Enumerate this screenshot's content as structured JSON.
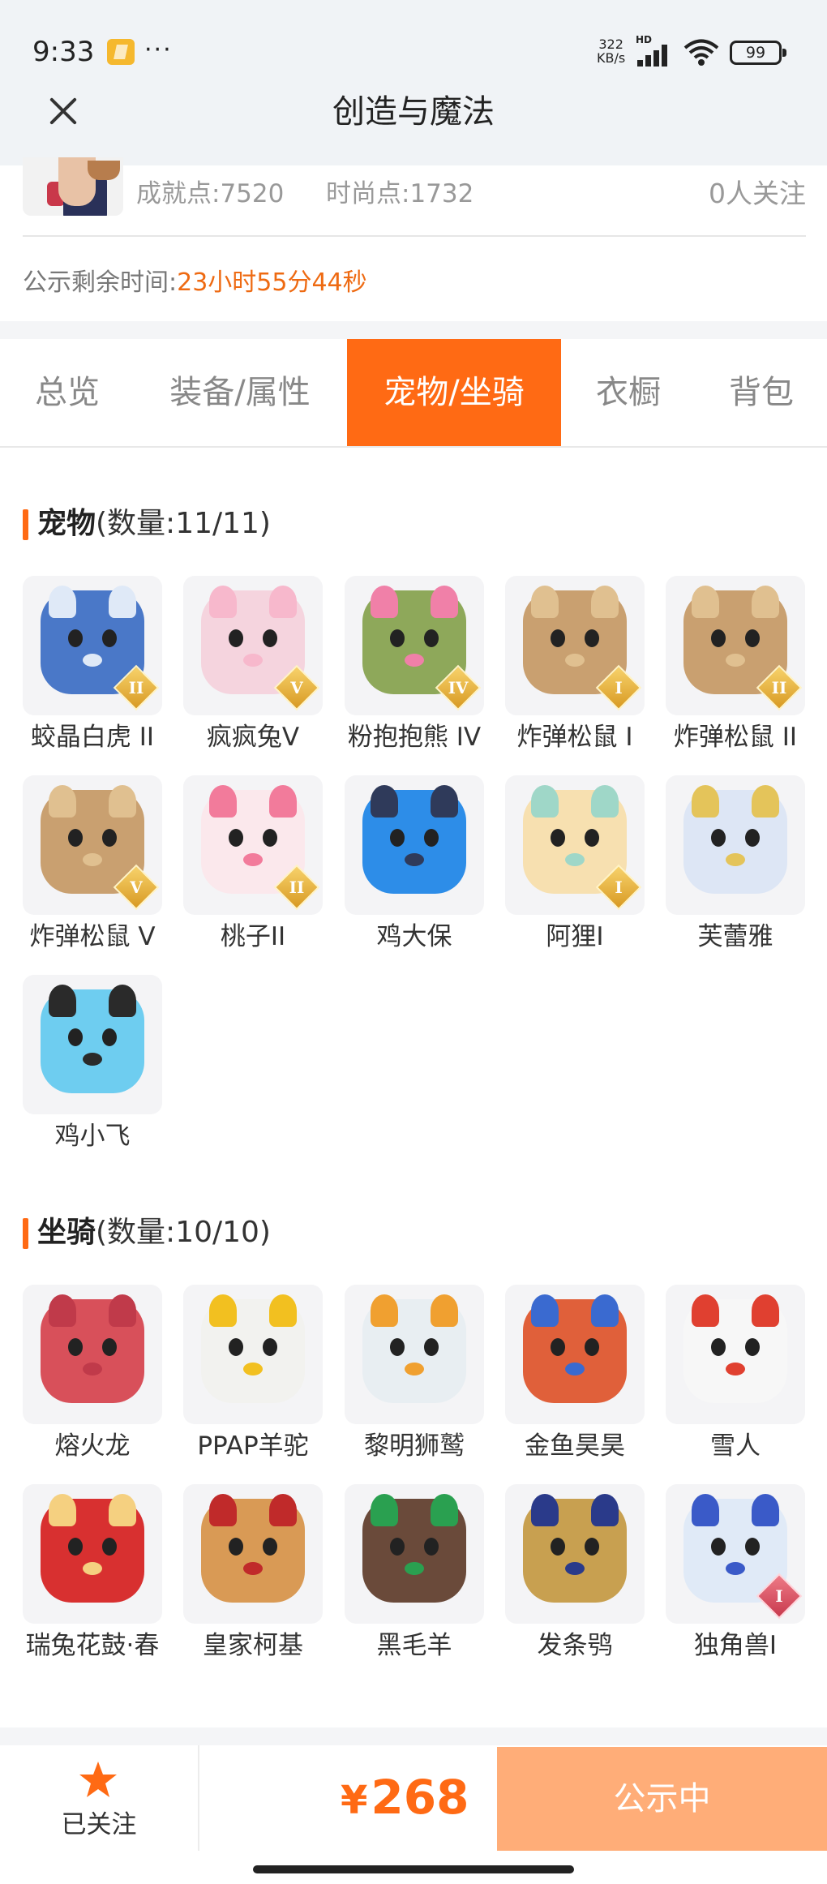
{
  "status_bar": {
    "time": "9:33",
    "more": "···",
    "speed_value": "322",
    "speed_unit": "KB/s",
    "network": "HD",
    "battery": "99"
  },
  "header": {
    "title": "创造与魔法"
  },
  "profile": {
    "achievement": "成就点:7520",
    "fashion": "时尚点:1732",
    "followers": "0人关注",
    "notice_label": "公示剩余时间:",
    "countdown": "23小时55分44秒"
  },
  "tabs": [
    {
      "label": "总览"
    },
    {
      "label": "装备/属性"
    },
    {
      "label": "宠物/坐骑"
    },
    {
      "label": "衣橱"
    },
    {
      "label": "背包"
    }
  ],
  "pets": {
    "title": "宠物",
    "count": "(数量:11/11)",
    "items": [
      {
        "name": "蛟晶白虎 II",
        "badge": "II",
        "color": "#4a78c8",
        "ear": "#dfe9f7"
      },
      {
        "name": "疯疯兔V",
        "badge": "V",
        "color": "#f5d4de",
        "ear": "#f7b8cc"
      },
      {
        "name": "粉抱抱熊 IV",
        "badge": "IV",
        "color": "#8ea85a",
        "ear": "#f080a8"
      },
      {
        "name": "炸弹松鼠 I",
        "badge": "I",
        "color": "#c9a070",
        "ear": "#e0c090"
      },
      {
        "name": "炸弹松鼠 II",
        "badge": "II",
        "color": "#c9a070",
        "ear": "#e0c090"
      },
      {
        "name": "炸弹松鼠 V",
        "badge": "V",
        "color": "#c9a070",
        "ear": "#e0c090"
      },
      {
        "name": "桃子II",
        "badge": "II",
        "color": "#fbe8ec",
        "ear": "#f27b9b"
      },
      {
        "name": "鸡大保",
        "badge": "",
        "color": "#2d8de8",
        "ear": "#2f3a5a"
      },
      {
        "name": "阿狸I",
        "badge": "I",
        "color": "#f7e0b0",
        "ear": "#9fd7c8"
      },
      {
        "name": "芙蕾雅",
        "badge": "",
        "color": "#dde6f5",
        "ear": "#e4c45a"
      },
      {
        "name": "鸡小飞",
        "badge": "",
        "color": "#6ecdf0",
        "ear": "#2a2a2a"
      }
    ]
  },
  "mounts": {
    "title": "坐骑",
    "count": "(数量:10/10)",
    "items": [
      {
        "name": "熔火龙",
        "badge": "",
        "color": "#d8505a",
        "ear": "#c03a4a"
      },
      {
        "name": "PPAP羊驼",
        "badge": "",
        "color": "#f2f2ef",
        "ear": "#f2c020"
      },
      {
        "name": "黎明狮鹫",
        "badge": "",
        "color": "#e8eef2",
        "ear": "#f0a030"
      },
      {
        "name": "金鱼昊昊",
        "badge": "",
        "color": "#e0603a",
        "ear": "#3a6ad0"
      },
      {
        "name": "雪人",
        "badge": "",
        "color": "#f7f7f7",
        "ear": "#e04030"
      },
      {
        "name": "瑞兔花鼓·春",
        "badge": "",
        "color": "#d83030",
        "ear": "#f5d080"
      },
      {
        "name": "皇家柯基",
        "badge": "",
        "color": "#d99a55",
        "ear": "#c02a2a"
      },
      {
        "name": "黑毛羊",
        "badge": "",
        "color": "#6a4a3a",
        "ear": "#2aa050"
      },
      {
        "name": "发条鸮",
        "badge": "",
        "color": "#c8a050",
        "ear": "#2a3a8a"
      },
      {
        "name": "独角兽I",
        "badge": "I",
        "color": "#e0eaf7",
        "ear": "#3a5ac8"
      }
    ]
  },
  "bottom_bar": {
    "follow_label": "已关注",
    "currency": "¥",
    "price": "268",
    "status": "公示中"
  },
  "colors": {
    "accent": "#ff6a14",
    "status_button": "#ffad78",
    "countdown": "#ee6a12"
  }
}
